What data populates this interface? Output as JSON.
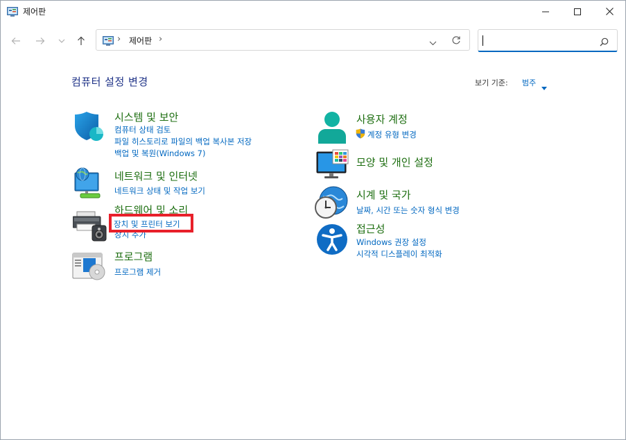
{
  "window": {
    "title": "제어판"
  },
  "address": {
    "crumb": "제어판",
    "chevron": "›"
  },
  "search": {
    "placeholder": ""
  },
  "main": {
    "heading": "컴퓨터 설정 변경",
    "view_by_label": "보기 기준:",
    "view_by_value": "범주"
  },
  "categories": [
    {
      "icon": "shield-icon",
      "title": "시스템 및 보안",
      "links": [
        "컴퓨터 상태 검토",
        "파일 히스토리로 파일의 백업 복사본 저장",
        "백업 및 복원(Windows 7)"
      ]
    },
    {
      "icon": "network-icon",
      "title": "네트워크 및 인터넷",
      "links": [
        "네트워크 상태 및 작업 보기"
      ]
    },
    {
      "icon": "printer-icon",
      "title": "하드웨어 및 소리",
      "links": [
        "장치 및 프린터 보기",
        "장치 추가"
      ]
    },
    {
      "icon": "programs-icon",
      "title": "프로그램",
      "links": [
        "프로그램 제거"
      ]
    },
    {
      "icon": "user-icon",
      "title": "사용자 계정",
      "links": [
        "계정 유형 변경"
      ]
    },
    {
      "icon": "appearance-icon",
      "title": "모양 및 개인 설정",
      "links": []
    },
    {
      "icon": "clock-globe-icon",
      "title": "시계 및 국가",
      "links": [
        "날짜, 시간 또는 숫자 형식 변경"
      ]
    },
    {
      "icon": "accessibility-icon",
      "title": "접근성",
      "links": [
        "Windows 권장 설정",
        "시각적 디스플레이 최적화"
      ]
    }
  ],
  "colors": {
    "title_green": "#1d6e10",
    "link_blue": "#0067c0",
    "heading_blue": "#1e3287",
    "highlight_red": "#e8202a"
  }
}
